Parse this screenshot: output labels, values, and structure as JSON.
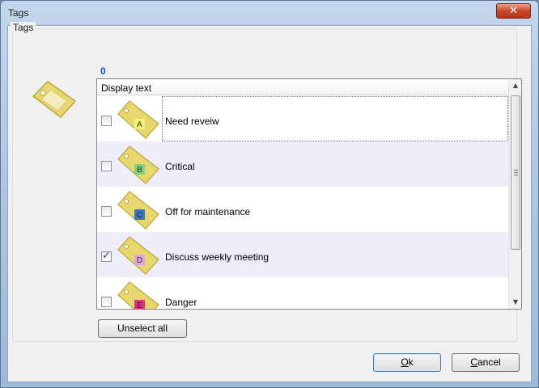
{
  "window": {
    "title": "Tags",
    "close_glyph": "✕"
  },
  "group": {
    "label": "Tags"
  },
  "count": "0",
  "list": {
    "header": "Display text",
    "items": [
      {
        "letter": "A",
        "label": "Need reveiw",
        "checked": false,
        "color": "#f2f27a"
      },
      {
        "letter": "B",
        "label": "Critical",
        "checked": false,
        "color": "#7ed07a"
      },
      {
        "letter": "C",
        "label": "Off for maintenance",
        "checked": false,
        "color": "#3a76c2"
      },
      {
        "letter": "D",
        "label": "Discuss weekly meeting",
        "checked": true,
        "color": "#e0a4df"
      },
      {
        "letter": "E",
        "label": "Danger",
        "checked": false,
        "color": "#e0308a"
      }
    ]
  },
  "buttons": {
    "unselect_all": "Unselect all",
    "ok_mnemonic": "O",
    "ok_rest": "k",
    "cancel_mnemonic": "C",
    "cancel_rest": "ancel"
  },
  "colors": {
    "tag_body": "#e6d46b",
    "tag_border": "#c9b744",
    "count_color": "#1f4fd1"
  },
  "icons": [
    "close-icon",
    "tag-icon",
    "checkbox-icon",
    "scroll-up-icon",
    "scroll-down-icon"
  ]
}
